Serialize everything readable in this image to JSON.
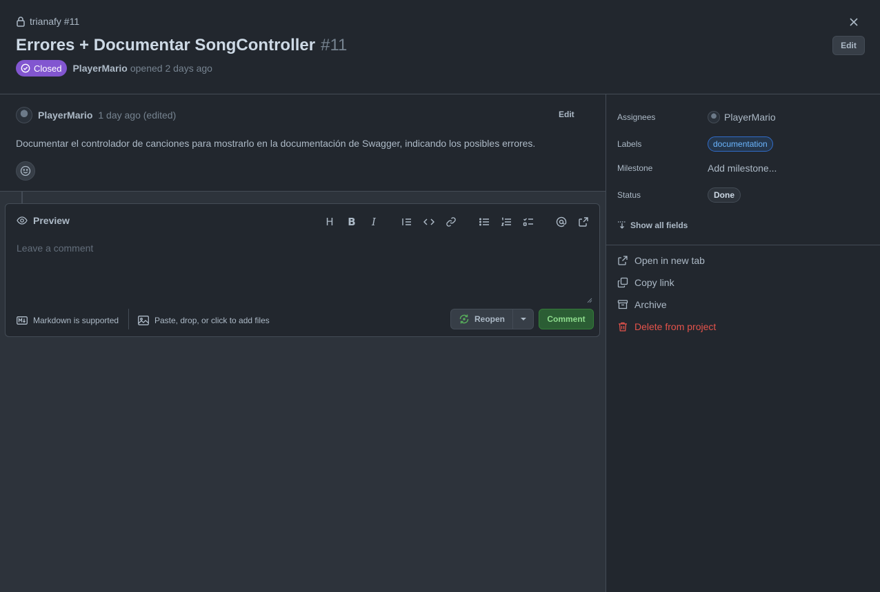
{
  "header": {
    "repo": "trianafy #11",
    "title": "Errores + Documentar SongController",
    "number": "#11",
    "state_badge": "Closed",
    "author": "PlayerMario",
    "opened_text": "opened 2 days ago",
    "edit_label": "Edit",
    "close_icon": "close-icon"
  },
  "comment": {
    "author": "PlayerMario",
    "time": "1 day ago (edited)",
    "edit_label": "Edit",
    "body": "Documentar el controlador de canciones para mostrarlo en la documentación de Swagger, indicando los posibles errores."
  },
  "editor": {
    "preview_label": "Preview",
    "toolbar_icons": [
      "heading-icon",
      "bold-icon",
      "italic-icon",
      "quote-icon",
      "code-icon",
      "link-icon",
      "unordered-list-icon",
      "ordered-list-icon",
      "task-list-icon",
      "mention-icon",
      "reference-icon"
    ],
    "toolbar": {
      "heading": "H",
      "bold": "B",
      "italic": "I"
    },
    "placeholder": "Leave a comment",
    "markdown_note": "Markdown is supported",
    "attach_note": "Paste, drop, or click to add files",
    "reopen_label": "Reopen",
    "comment_label": "Comment"
  },
  "sidebar": {
    "fields": [
      {
        "label": "Assignees",
        "value": "PlayerMario"
      },
      {
        "label": "Labels",
        "value": "documentation"
      },
      {
        "label": "Milestone",
        "value": "Add milestone..."
      },
      {
        "label": "Status",
        "value": "Done"
      }
    ],
    "show_all": "Show all fields",
    "actions": [
      {
        "label": "Open in new tab"
      },
      {
        "label": "Copy link"
      },
      {
        "label": "Archive"
      },
      {
        "label": "Delete from project"
      }
    ]
  },
  "colors": {
    "closed_badge": "#8256d0",
    "label_pill": "#6cb6ff",
    "danger": "#e5534b",
    "comment_button": "#2b5d34"
  }
}
